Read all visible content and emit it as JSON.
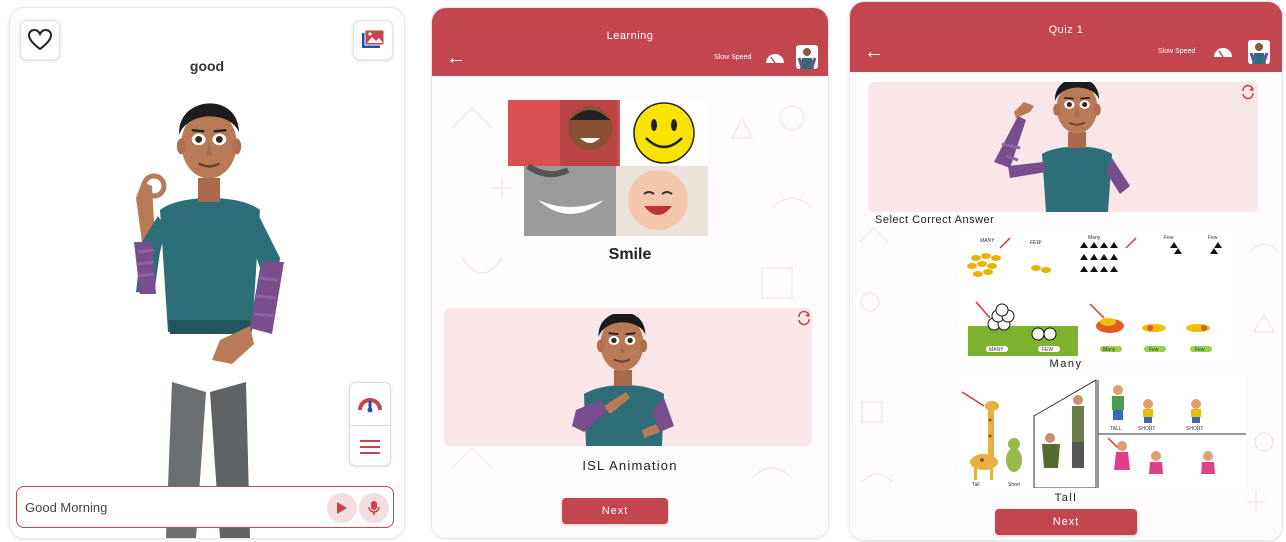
{
  "screen1": {
    "word": "good",
    "input_value": "Good Morning",
    "icons": [
      "heart-icon",
      "gallery-icon",
      "speed-gauge-icon",
      "menu-icon",
      "play-icon",
      "mic-icon"
    ]
  },
  "screen2": {
    "header_title": "Learning",
    "speed_label": "Slow Speed",
    "word": "Smile",
    "animation_label": "ISL Animation",
    "next_label": "Next"
  },
  "screen3": {
    "header_title": "Quiz 1",
    "speed_label": "Slow Speed",
    "question": "Select Correct Answer",
    "options": [
      {
        "label": "Many",
        "image_text": [
          "MANY",
          "FEW",
          "Many",
          "Few",
          "Few",
          "MANY",
          "FEW",
          "Many",
          "Few",
          "Few"
        ]
      },
      {
        "label": "Tall",
        "image_text": [
          "Tall",
          "Short",
          "TALL",
          "SHORT",
          "SHORT"
        ]
      }
    ],
    "next_label": "Next"
  },
  "colors": {
    "accent": "#c3464f",
    "pink_bg": "#f9e6e8",
    "shirt": "#2e6e78",
    "sleeve": "#7a4d8f"
  }
}
